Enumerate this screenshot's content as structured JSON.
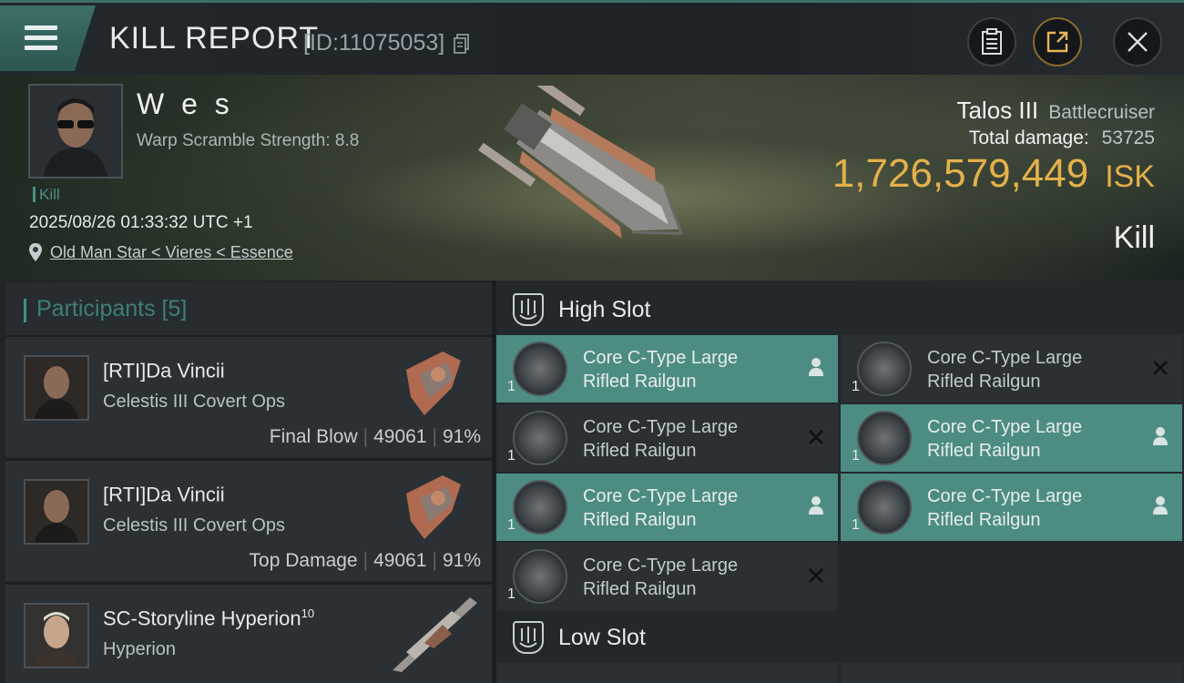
{
  "header": {
    "title": "KILL REPORT",
    "report_id": "[ID:11075053]"
  },
  "victim": {
    "name": "W e s",
    "warp_scramble": "Warp Scramble Strength: 8.8",
    "tag": "Kill",
    "datetime": "2025/08/26 01:33:32 UTC +1",
    "location": "Old Man Star < Vieres < Essence",
    "ship_name": "Talos III",
    "ship_class": "Battlecruiser",
    "total_damage_label": "Total damage:",
    "total_damage": "53725",
    "isk_value": "1,726,579,449",
    "isk_unit": "ISK",
    "result": "Kill"
  },
  "participants": {
    "label": "Participants [5]",
    "rows": [
      {
        "name": "[RTI]Da Vincii",
        "sup": "",
        "ship": "Celestis III Covert Ops",
        "role": "Final Blow",
        "damage": "49061",
        "percent": "91%"
      },
      {
        "name": "[RTI]Da Vincii",
        "sup": "",
        "ship": "Celestis III Covert Ops",
        "role": "Top Damage",
        "damage": "49061",
        "percent": "91%"
      },
      {
        "name": "SC-Storyline Hyperion",
        "sup": "10",
        "ship": "Hyperion",
        "role": "",
        "damage": "",
        "percent": ""
      }
    ]
  },
  "slots": {
    "high_label": "High Slot",
    "low_label": "Low Slot",
    "high_modules": [
      {
        "line1": "Core C-Type Large",
        "line2": "Rifled Railgun",
        "qty": "1",
        "state": "dropped",
        "status_icon": "person-icon"
      },
      {
        "line1": "Core C-Type Large",
        "line2": "Rifled Railgun",
        "qty": "1",
        "state": "destroyed",
        "status_icon": "x-icon"
      },
      {
        "line1": "Core C-Type Large",
        "line2": "Rifled Railgun",
        "qty": "1",
        "state": "destroyed",
        "status_icon": "x-icon"
      },
      {
        "line1": "Core C-Type Large",
        "line2": "Rifled Railgun",
        "qty": "1",
        "state": "dropped",
        "status_icon": "person-icon"
      },
      {
        "line1": "Core C-Type Large",
        "line2": "Rifled Railgun",
        "qty": "1",
        "state": "dropped",
        "status_icon": "person-icon"
      },
      {
        "line1": "Core C-Type Large",
        "line2": "Rifled Railgun",
        "qty": "1",
        "state": "dropped",
        "status_icon": "person-icon"
      },
      {
        "line1": "Core C-Type Large",
        "line2": "Rifled Railgun",
        "qty": "1",
        "state": "destroyed",
        "status_icon": "x-icon"
      }
    ]
  },
  "colors": {
    "accent": "#4d8c83",
    "isk": "#e3b14a"
  }
}
